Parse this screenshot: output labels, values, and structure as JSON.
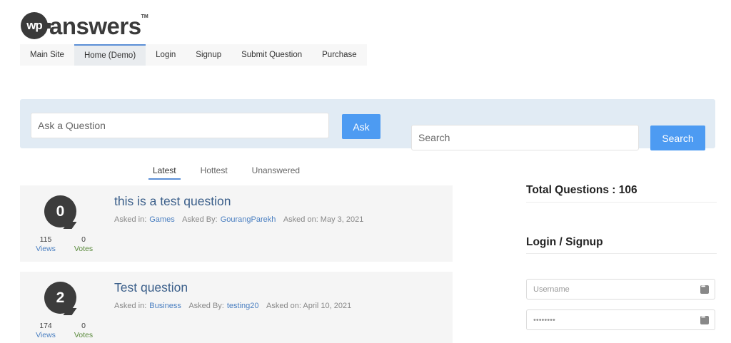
{
  "brand": {
    "logo_badge": "wp",
    "logo_word": "answers",
    "logo_tm": "TM"
  },
  "nav": [
    {
      "label": "Main Site"
    },
    {
      "label": "Home (Demo)",
      "active": true
    },
    {
      "label": "Login"
    },
    {
      "label": "Signup"
    },
    {
      "label": "Submit Question"
    },
    {
      "label": "Purchase"
    }
  ],
  "ask": {
    "placeholder": "Ask a Question",
    "button_label": "Ask"
  },
  "search": {
    "placeholder": "Search",
    "button_label": "Search"
  },
  "sort_tabs": [
    {
      "label": "Latest",
      "active": true
    },
    {
      "label": "Hottest"
    },
    {
      "label": "Unanswered"
    }
  ],
  "questions": [
    {
      "answers": "0",
      "title": "this is a test question",
      "views": "115",
      "views_label": "Views",
      "votes": "0",
      "votes_label": "Votes",
      "asked_in_label": "Asked in:",
      "category": "Games",
      "asked_by_label": "Asked By:",
      "author": "GourangParekh",
      "asked_on": "Asked on: May 3, 2021"
    },
    {
      "answers": "2",
      "title": "Test question",
      "views": "174",
      "views_label": "Views",
      "votes": "0",
      "votes_label": "Votes",
      "asked_in_label": "Asked in:",
      "category": "Business",
      "asked_by_label": "Asked By:",
      "author": "testing20",
      "asked_on": "Asked on: April 10, 2021"
    }
  ],
  "sidebar": {
    "total_questions": "Total Questions : 106",
    "login_heading": "Login / Signup",
    "username_placeholder": "Username",
    "password_placeholder": "••••••••"
  },
  "colors": {
    "accent_blue": "#4d9bf2",
    "band": "#e1ebf4",
    "title_link": "#3b5f8a"
  }
}
